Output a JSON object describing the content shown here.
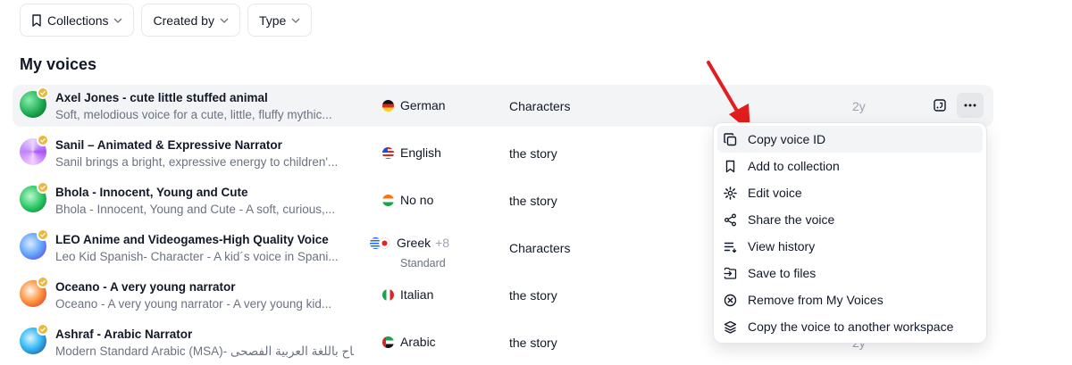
{
  "filters": [
    {
      "label": "Collections",
      "icon": "bookmark-icon"
    },
    {
      "label": "Created by"
    },
    {
      "label": "Type"
    }
  ],
  "section_title": "My voices",
  "voices": [
    {
      "name": "Axel Jones - cute little stuffed animal",
      "description": "Soft, melodious voice for a cute, little, fluffy mythic...",
      "language": "German",
      "category": "Characters",
      "age": "2y",
      "avatar_color": "#22c55e"
    },
    {
      "name": "Sanil – Animated & Expressive Narrator",
      "description": "Sanil brings a bright, expressive energy to children'...",
      "language": "English",
      "category": "the story",
      "avatar_color": "#c084fc"
    },
    {
      "name": "Bhola - Innocent, Young and Cute",
      "description": "Bhola - Innocent, Young and Cute - A soft, curious,...",
      "language": "No no",
      "category": "the story",
      "avatar_color": "#16a34a"
    },
    {
      "name": "LEO Anime and Videogames-High Quality Voice",
      "description": "Leo Kid Spanish- Character - A kid´s voice in Spani...",
      "language": "Greek",
      "language_extra": "+8",
      "language_sub": "Standard",
      "category": "Characters",
      "avatar_color": "#3b82f6"
    },
    {
      "name": "Oceano - A very young narrator",
      "description": "Oceano - A very young narrator - A very young kid...",
      "language": "Italian",
      "category": "the story",
      "avatar_color": "#f87171"
    },
    {
      "name": "Ashraf - Arabic Narrator",
      "description": "Modern Standard Arabic (MSA)- متاح باللغة العربية الفصحى",
      "language": "Arabic",
      "category": "the story",
      "age": "2y",
      "avatar_color": "#2563eb"
    }
  ],
  "menu": {
    "items": [
      {
        "label": "Copy voice ID",
        "icon": "copy-icon"
      },
      {
        "label": "Add to collection",
        "icon": "bookmark-icon"
      },
      {
        "label": "Edit voice",
        "icon": "gear-icon"
      },
      {
        "label": "Share the voice",
        "icon": "share-icon"
      },
      {
        "label": "View history",
        "icon": "history-list-icon"
      },
      {
        "label": "Save to files",
        "icon": "save-to-files-icon"
      },
      {
        "label": "Remove from My Voices",
        "icon": "remove-circle-icon"
      },
      {
        "label": "Copy the voice to another workspace",
        "icon": "layers-icon"
      }
    ]
  },
  "colors": {
    "accent_arrow": "#e11d1d",
    "verified_badge": "#e9b83c",
    "row_highlight": "#f3f4f6"
  }
}
